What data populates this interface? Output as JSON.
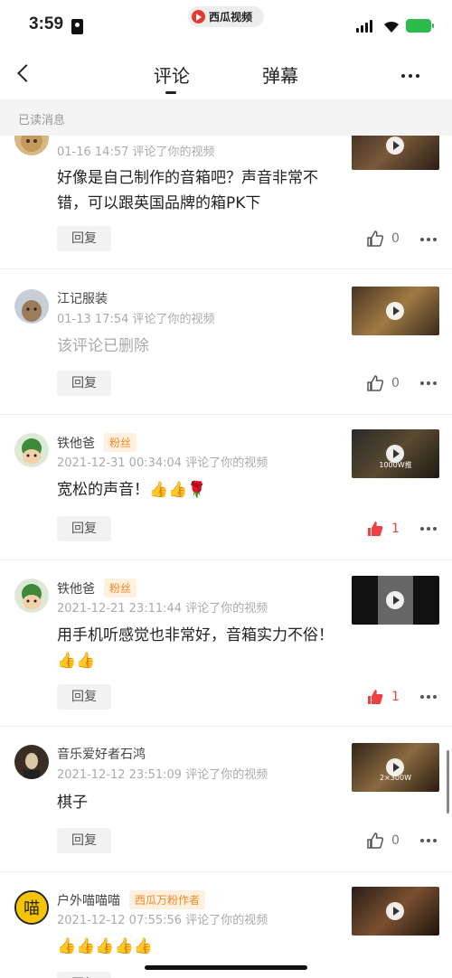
{
  "status_bar": {
    "time": "3:59",
    "app_name": "西瓜视频"
  },
  "nav": {
    "tab_comment": "评论",
    "tab_danmaku": "弹幕"
  },
  "read_bar": "已读消息",
  "items": [
    {
      "name": "",
      "meta": "01-16 14:57 评论了你的视频",
      "text": "好像是自己制作的音箱吧？声音非常不错，可以跟英国品牌的箱PK下",
      "reply": "回复",
      "likes": "0",
      "liked": false,
      "thumb_caption": ""
    },
    {
      "name": "江记服装",
      "meta": "01-13 17:54 评论了你的视频",
      "text": "该评论已删除",
      "reply": "回复",
      "likes": "0",
      "liked": false,
      "thumb_caption": ""
    },
    {
      "name": "铁他爸",
      "badge": "粉丝",
      "meta": "2021-12-31 00:34:04 评论了你的视频",
      "text": "宽松的声音！👍👍🌹",
      "reply": "回复",
      "likes": "1",
      "liked": true,
      "thumb_caption": "1000W推"
    },
    {
      "name": "铁他爸",
      "badge": "粉丝",
      "meta": "2021-12-21 23:11:44 评论了你的视频",
      "text": "用手机听感觉也非常好，音箱实力不俗！👍👍",
      "reply": "回复",
      "likes": "1",
      "liked": true,
      "thumb_caption": ""
    },
    {
      "name": "音乐爱好者石鸿",
      "meta": "2021-12-12 23:51:09 评论了你的视频",
      "text": "棋子",
      "reply": "回复",
      "likes": "0",
      "liked": false,
      "thumb_caption": "2×300W"
    },
    {
      "name": "户外喵喵喵",
      "badge": "西瓜万粉作者",
      "meta": "2021-12-12 07:55:56 评论了你的视频",
      "text": "👍👍👍👍👍",
      "reply": "回复",
      "likes": "",
      "liked": false,
      "thumb_caption": ""
    }
  ],
  "colors": {
    "like_active": "#f04142",
    "badge_text": "#f08a24",
    "badge_bg": "#fff0e0"
  }
}
